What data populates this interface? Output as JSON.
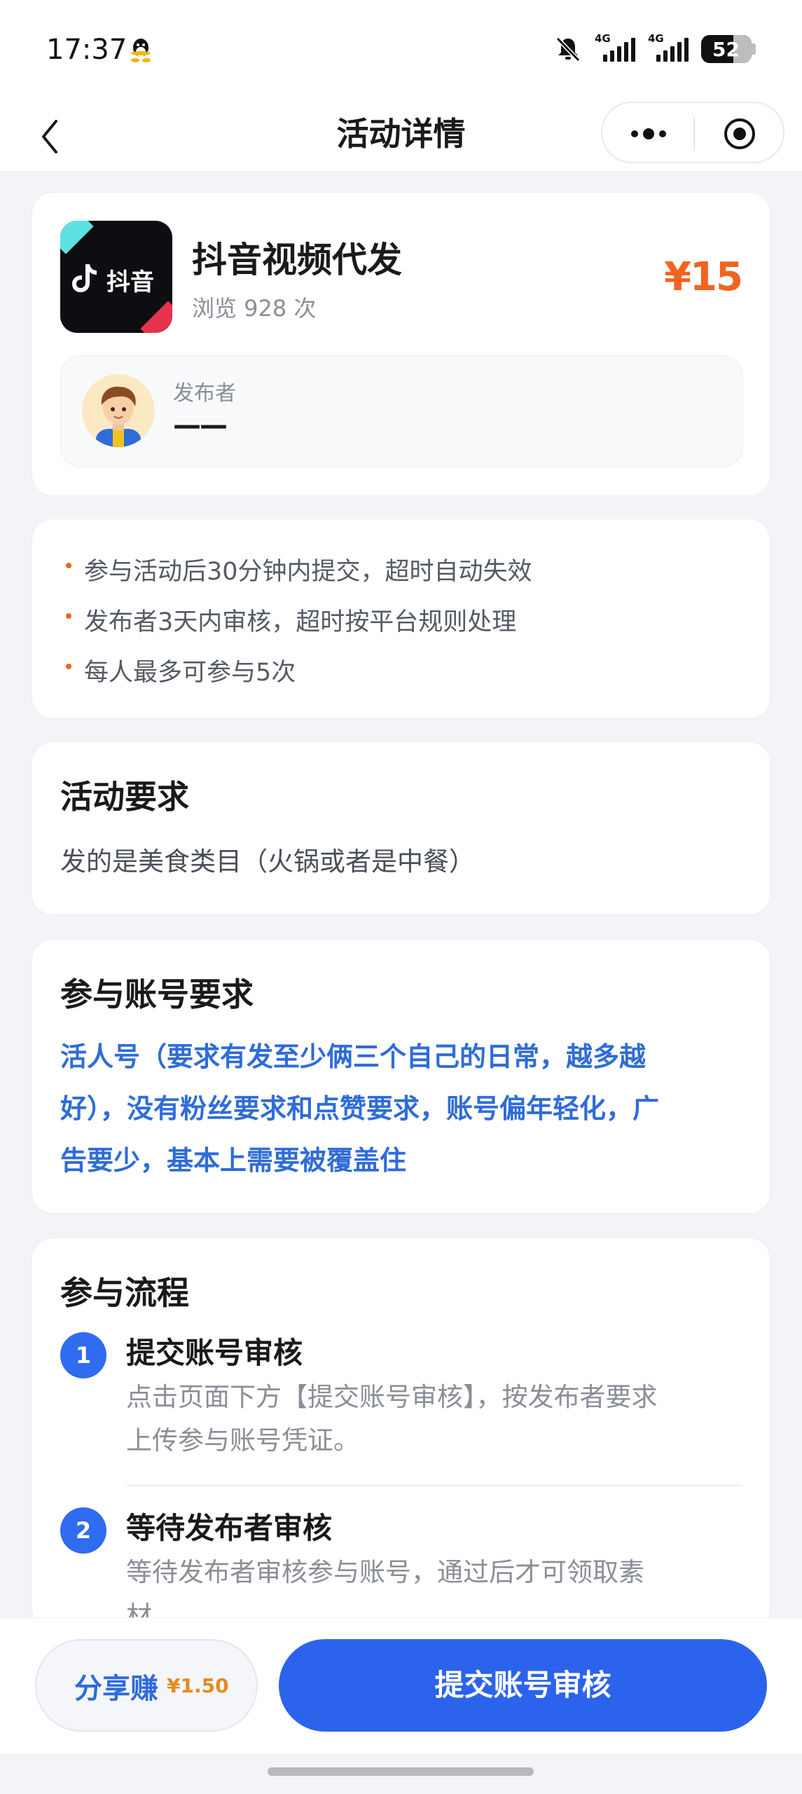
{
  "status_bar": {
    "time": "17:37",
    "signal1_label": "4G",
    "signal2_label": "4G",
    "battery": "52",
    "icons": [
      "qq-icon",
      "mute-icon",
      "signal-icon",
      "battery-icon"
    ]
  },
  "nav": {
    "title": "活动详情",
    "icons": [
      "back-icon",
      "more-icon",
      "record-icon"
    ]
  },
  "activity": {
    "logo_text": "抖音",
    "title": "抖音视频代发",
    "views": "浏览 928 次",
    "price": "¥15",
    "publisher_label": "发布者",
    "publisher_name": "——"
  },
  "rules": [
    "参与活动后30分钟内提交，超时自动失效",
    "发布者3天内审核，超时按平台规则处理",
    "每人最多可参与5次"
  ],
  "requirements": {
    "title": "活动要求",
    "body": "发的是美食类目（火锅或者是中餐）"
  },
  "account_requirements": {
    "title": "参与账号要求",
    "lines": [
      "活人号（要求有发至少俩三个自己的日常，越多越",
      "好），没有粉丝要求和点赞要求，账号偏年轻化，广",
      "告要少，基本上需要被覆盖住"
    ]
  },
  "process": {
    "title": "参与流程",
    "steps": [
      {
        "num": "1",
        "title": "提交账号审核",
        "desc_lines": [
          "点击页面下方【提交账号审核】，按发布者要求",
          "上传参与账号凭证。"
        ]
      },
      {
        "num": "2",
        "title": "等待发布者审核",
        "desc_lines": [
          "等待发布者审核参与账号，通过后才可领取素",
          "材"
        ]
      }
    ]
  },
  "bottom": {
    "share_label": "分享赚",
    "share_amount": "¥1.50",
    "submit_label": "提交账号审核"
  },
  "colors": {
    "accent_blue": "#2c63ec",
    "price_orange": "#f0641f",
    "link_blue": "#2f6cd8"
  }
}
